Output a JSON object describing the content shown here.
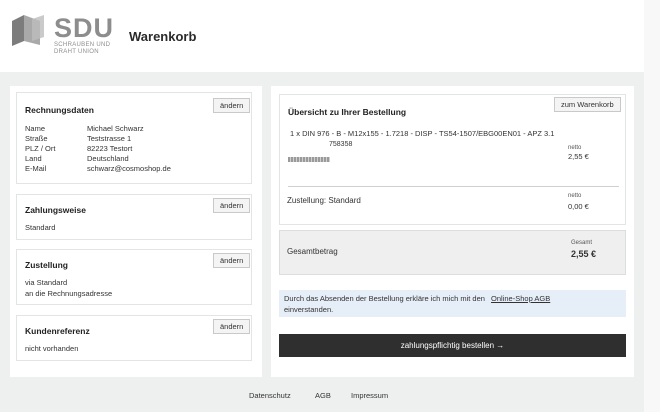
{
  "header": {
    "logo_text": "SDU",
    "logo_subtext": "SCHRAUBEN UND DRAHT UNION",
    "title": "Warenkorb"
  },
  "billing": {
    "title": "Rechnungsdaten",
    "edit_label": "ändern",
    "rows": [
      {
        "label": "Name",
        "value": "Michael Schwarz"
      },
      {
        "label": "Straße",
        "value": "Teststrasse 1"
      },
      {
        "label": "PLZ / Ort",
        "value": "82223 Testort"
      },
      {
        "label": "Land",
        "value": "Deutschland"
      },
      {
        "label": "E-Mail",
        "value": "schwarz@cosmoshop.de"
      }
    ]
  },
  "payment": {
    "title": "Zahlungsweise",
    "edit_label": "ändern",
    "value": "Standard"
  },
  "delivery": {
    "title": "Zustellung",
    "edit_label": "ändern",
    "line1": "via Standard",
    "line2": "an die Rechnungsadresse"
  },
  "reference": {
    "title": "Kundenreferenz",
    "edit_label": "ändern",
    "value": "nicht vorhanden"
  },
  "order": {
    "title": "Übersicht zu Ihrer Bestellung",
    "cart_button": "zum Warenkorb",
    "item_text": "1 x DIN 976 - B - M12x155 - 1.7218 - DISP - TS54-1507/EBG00EN01 - APZ 3.1",
    "item_number": "758358",
    "item_price_label": "netto",
    "item_price": "2,55 €",
    "shipping_label": "Zustellung: Standard",
    "shipping_price_label": "netto",
    "shipping_price": "0,00 €"
  },
  "total": {
    "label": "Gesamtbetrag",
    "small_label": "Gesamt",
    "value": "2,55 €"
  },
  "consent": {
    "text_before": "Durch das Absenden der Bestellung erkläre ich mich mit den",
    "link": "Online-Shop AGB",
    "text_after": "einverstanden."
  },
  "submit": {
    "label": "zahlungspflichtig bestellen →"
  },
  "footer": {
    "links": [
      "Datenschutz",
      "AGB",
      "Impressum"
    ]
  }
}
